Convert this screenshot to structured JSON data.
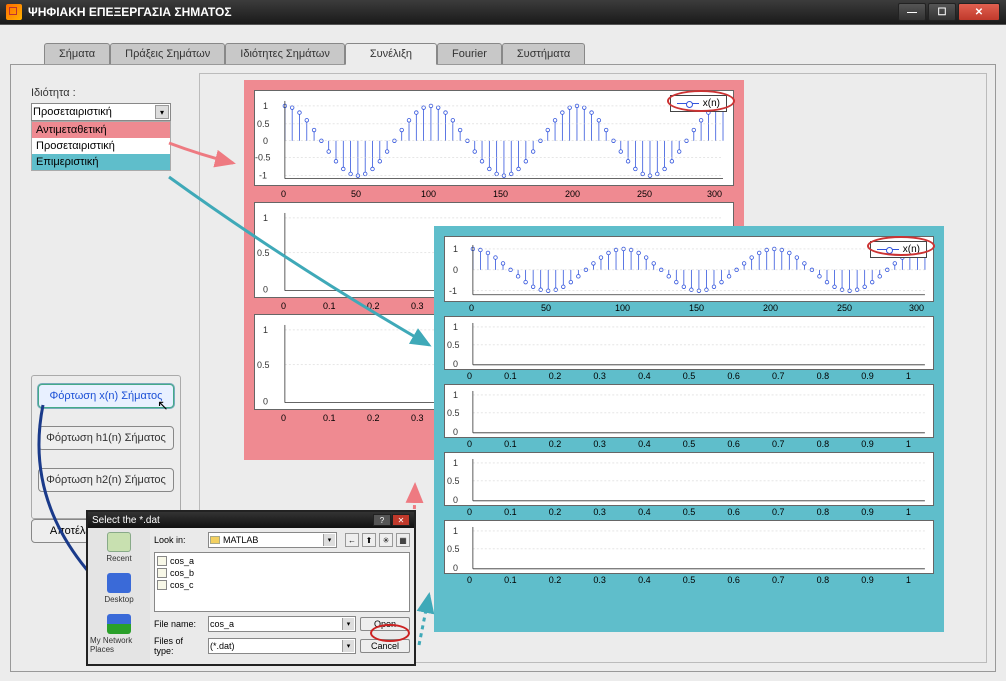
{
  "window": {
    "title": "ΨΗΦΙΑΚΗ ΕΠΕΞΕΡΓΑΣΙΑ ΣΗΜΑΤΟΣ"
  },
  "tabs": {
    "t0": "Σήματα",
    "t1": "Πράξεις Σημάτων",
    "t2": "Ιδιότητες Σημάτων",
    "t3": "Συνέλιξη",
    "t4": "Fourier",
    "t5": "Συστήματα",
    "active": "Συνέλιξη"
  },
  "property": {
    "label": "Ιδιότητα :",
    "selected": "Προσεταιριστική",
    "opt1": "Αντιμεταθετική",
    "opt2": "Προσεταιριστική",
    "opt3": "Επιμεριστική"
  },
  "buttons": {
    "loadx": "Φόρτωση x(n) Σήματος",
    "loadh1": "Φόρτωση h1(n) Σήματος",
    "loadh2": "Φόρτωση h2(n) Σήματος",
    "results": "Αποτέλεσ"
  },
  "legend": {
    "label": "x(n)"
  },
  "file_dialog": {
    "title": "Select the *.dat",
    "lookin_label": "Look in:",
    "lookin_value": "MATLAB",
    "places": {
      "recent": "Recent",
      "desktop": "Desktop",
      "network": "My Network Places"
    },
    "files": {
      "f1": "cos_a",
      "f2": "cos_b",
      "f3": "cos_c"
    },
    "filename_label": "File name:",
    "filename_value": "cos_a",
    "filetype_label": "Files of type:",
    "filetype_value": "(*.dat)",
    "open": "Open",
    "cancel": "Cancel"
  },
  "chart_data": [
    {
      "type": "line",
      "title": "",
      "series": [
        {
          "name": "x(n)",
          "x_range": [
            0,
            300
          ],
          "y_range": [
            -1,
            1
          ],
          "function": "damped/modulated sinusoid stems",
          "est_period": 100,
          "approx_formula": "cos(2*pi*n/100) sampled 0..300"
        }
      ],
      "xticks": [
        0,
        50,
        100,
        150,
        200,
        250,
        300
      ],
      "yticks": [
        -1,
        -0.5,
        0,
        0.5,
        1
      ],
      "legend": [
        "x(n)"
      ],
      "container": "pink-frame"
    },
    {
      "type": "line",
      "title": "",
      "series": [
        {
          "name": "x(n)",
          "x_range": [
            0,
            300
          ],
          "y_range": [
            -1,
            1
          ],
          "function": "same sinusoid stems",
          "est_period": 100
        }
      ],
      "xticks": [
        0,
        50,
        100,
        150,
        200,
        250,
        300
      ],
      "yticks": [
        -1,
        0,
        1
      ],
      "legend": [
        "x(n)"
      ],
      "container": "teal-frame"
    },
    {
      "type": "line",
      "series": [],
      "xticks": [
        0,
        0.1,
        0.2,
        0.3,
        0.4,
        0.5,
        0.6,
        0.7,
        0.8,
        0.9,
        1
      ],
      "yticks": [
        0,
        0.5,
        1
      ],
      "y_range": [
        0,
        1
      ],
      "x_range": [
        0,
        1
      ],
      "container": "pink-frame-sub"
    },
    {
      "type": "line",
      "series": [],
      "xticks": [
        0,
        0.1,
        0.2,
        0.3,
        0.4,
        0.5,
        0.6,
        0.7,
        0.8,
        0.9,
        1
      ],
      "yticks": [
        0,
        0.5,
        1
      ],
      "y_range": [
        0,
        1
      ],
      "x_range": [
        0,
        1
      ],
      "container": "teal-frame-sub",
      "count": 4
    }
  ]
}
